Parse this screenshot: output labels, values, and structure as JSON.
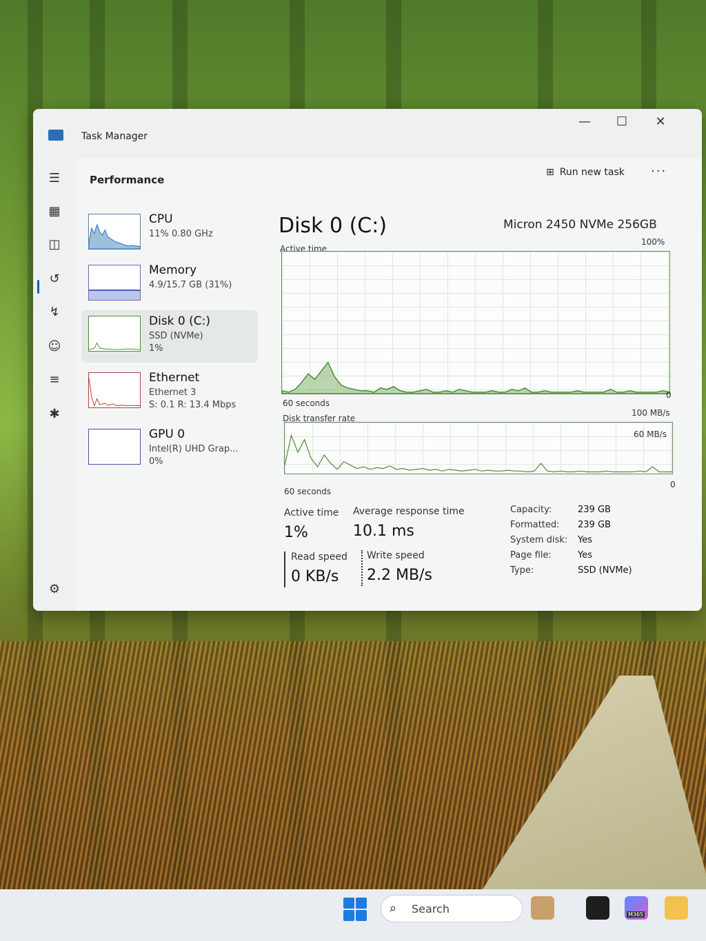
{
  "window": {
    "title": "Task Manager",
    "minimize": "—",
    "maximize": "☐",
    "close": "✕"
  },
  "header": {
    "page_title": "Performance",
    "run_new_task": "Run new task",
    "more": "···"
  },
  "nav_icons": [
    "hamburger-icon",
    "processes-icon",
    "performance-icon",
    "app-history-icon",
    "startup-apps-icon",
    "users-icon",
    "details-icon",
    "services-icon",
    "settings-icon"
  ],
  "sidebar": {
    "cpu": {
      "name": "CPU",
      "sub": "11%  0.80 GHz"
    },
    "memory": {
      "name": "Memory",
      "sub": "4.9/15.7 GB (31%)"
    },
    "disk": {
      "name": "Disk 0 (C:)",
      "sub": "SSD (NVMe)",
      "sub2": "1%"
    },
    "ethernet": {
      "name": "Ethernet",
      "sub": "Ethernet 3",
      "sub2": "S: 0.1  R: 13.4 Mbps"
    },
    "gpu": {
      "name": "GPU 0",
      "sub": "Intel(R) UHD Grap...",
      "sub2": "0%"
    }
  },
  "detail": {
    "title": "Disk 0 (C:)",
    "model": "Micron 2450 NVMe 256GB",
    "active_time_label": "Active time",
    "active_time_max": "100%",
    "graph_time": "60 seconds",
    "graph_zero": "0",
    "transfer_label": "Disk transfer rate",
    "transfer_max": "100 MB/s",
    "transfer_mid": "60 MB/s",
    "transfer_time": "60 seconds",
    "transfer_zero": "0"
  },
  "stats": {
    "active_time_label": "Active time",
    "active_time_value": "1%",
    "avg_response_label": "Average response time",
    "avg_response_value": "10.1 ms",
    "read_label": "Read speed",
    "read_value": "0 KB/s",
    "write_label": "Write speed",
    "write_value": "2.2 MB/s"
  },
  "properties": [
    {
      "label": "Capacity:",
      "value": "239 GB"
    },
    {
      "label": "Formatted:",
      "value": "239 GB"
    },
    {
      "label": "System disk:",
      "value": "Yes"
    },
    {
      "label": "Page file:",
      "value": "Yes"
    },
    {
      "label": "Type:",
      "value": "SSD (NVMe)"
    }
  ],
  "taskbar": {
    "search_placeholder": "Search",
    "m365_label": "M365"
  },
  "colors": {
    "disk_green": "#6aa84f",
    "cpu_blue": "#2a6fb5",
    "eth_red": "#c0392b",
    "accent": "#1a5fb4"
  },
  "series": {
    "active_time": [
      2,
      1,
      3,
      8,
      14,
      10,
      16,
      22,
      12,
      6,
      4,
      3,
      2,
      2,
      1,
      4,
      3,
      5,
      2,
      1,
      1,
      2,
      3,
      1,
      1,
      2,
      1,
      3,
      2,
      1,
      1,
      1,
      2,
      1,
      1,
      3,
      2,
      4,
      1,
      1,
      2,
      1,
      1,
      1,
      1,
      2,
      1,
      1,
      1,
      1,
      3,
      1,
      1,
      2,
      1,
      1,
      1,
      1,
      2,
      1
    ],
    "transfer": [
      10,
      45,
      25,
      40,
      18,
      8,
      22,
      12,
      5,
      14,
      10,
      6,
      8,
      5,
      7,
      6,
      9,
      5,
      6,
      4,
      5,
      6,
      4,
      5,
      3,
      5,
      4,
      3,
      4,
      5,
      3,
      4,
      3,
      3,
      4,
      3,
      3,
      2,
      3,
      12,
      3,
      2,
      3,
      2,
      2,
      3,
      2,
      2,
      2,
      3,
      2,
      2,
      2,
      2,
      3,
      2,
      8,
      2,
      2,
      2
    ],
    "cpu_thumb": [
      20,
      60,
      45,
      70,
      50,
      40,
      55,
      35,
      30,
      25,
      20,
      18,
      15,
      12,
      10,
      8,
      10,
      9,
      8,
      7
    ],
    "eth_thumb": [
      85,
      30,
      5,
      25,
      8,
      10,
      12,
      6,
      8,
      10,
      6,
      5,
      7,
      6,
      5,
      5,
      6,
      5,
      5,
      5
    ]
  }
}
